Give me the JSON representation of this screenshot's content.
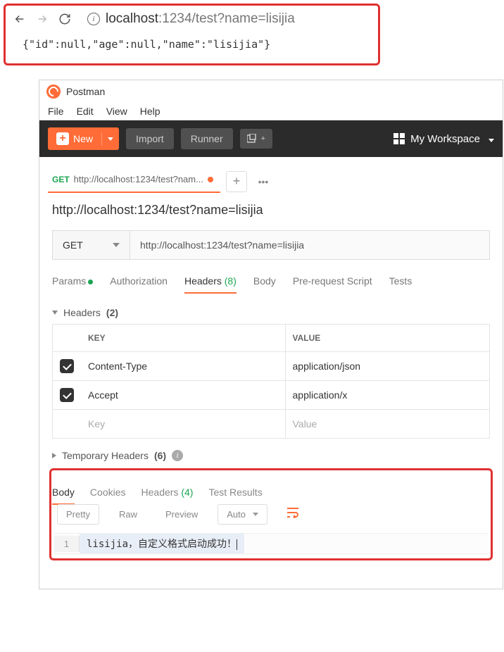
{
  "browser": {
    "url_host": "localhost",
    "url_port": ":1234",
    "url_path": "/test?name=lisijia",
    "body": "{\"id\":null,\"age\":null,\"name\":\"lisijia\"}"
  },
  "app": {
    "title": "Postman",
    "menu": {
      "file": "File",
      "edit": "Edit",
      "view": "View",
      "help": "Help"
    }
  },
  "toolbar": {
    "new_label": "New",
    "import_label": "Import",
    "runner_label": "Runner",
    "workspace_label": "My Workspace"
  },
  "tab": {
    "method": "GET",
    "url_short": "http://localhost:1234/test?nam..."
  },
  "request": {
    "title": "http://localhost:1234/test?name=lisijia",
    "method": "GET",
    "url": "http://localhost:1234/test?name=lisijia",
    "tabs": {
      "params": "Params",
      "auth": "Authorization",
      "headers": "Headers",
      "headers_count": "(8)",
      "body": "Body",
      "prereq": "Pre-request Script",
      "tests": "Tests"
    }
  },
  "headers_section": {
    "title": "Headers",
    "count": "(2)",
    "key_label": "KEY",
    "value_label": "VALUE",
    "rows": [
      {
        "key": "Content-Type",
        "value": "application/json"
      },
      {
        "key": "Accept",
        "value": "application/x"
      }
    ],
    "placeholder_key": "Key",
    "placeholder_value": "Value",
    "temp_title": "Temporary Headers",
    "temp_count": "(6)"
  },
  "response": {
    "tabs": {
      "body": "Body",
      "cookies": "Cookies",
      "headers": "Headers",
      "headers_count": "(4)",
      "tests": "Test Results"
    },
    "views": {
      "pretty": "Pretty",
      "raw": "Raw",
      "preview": "Preview",
      "auto": "Auto"
    },
    "line_no": "1",
    "content": "lisijia，自定义格式启动成功！"
  }
}
